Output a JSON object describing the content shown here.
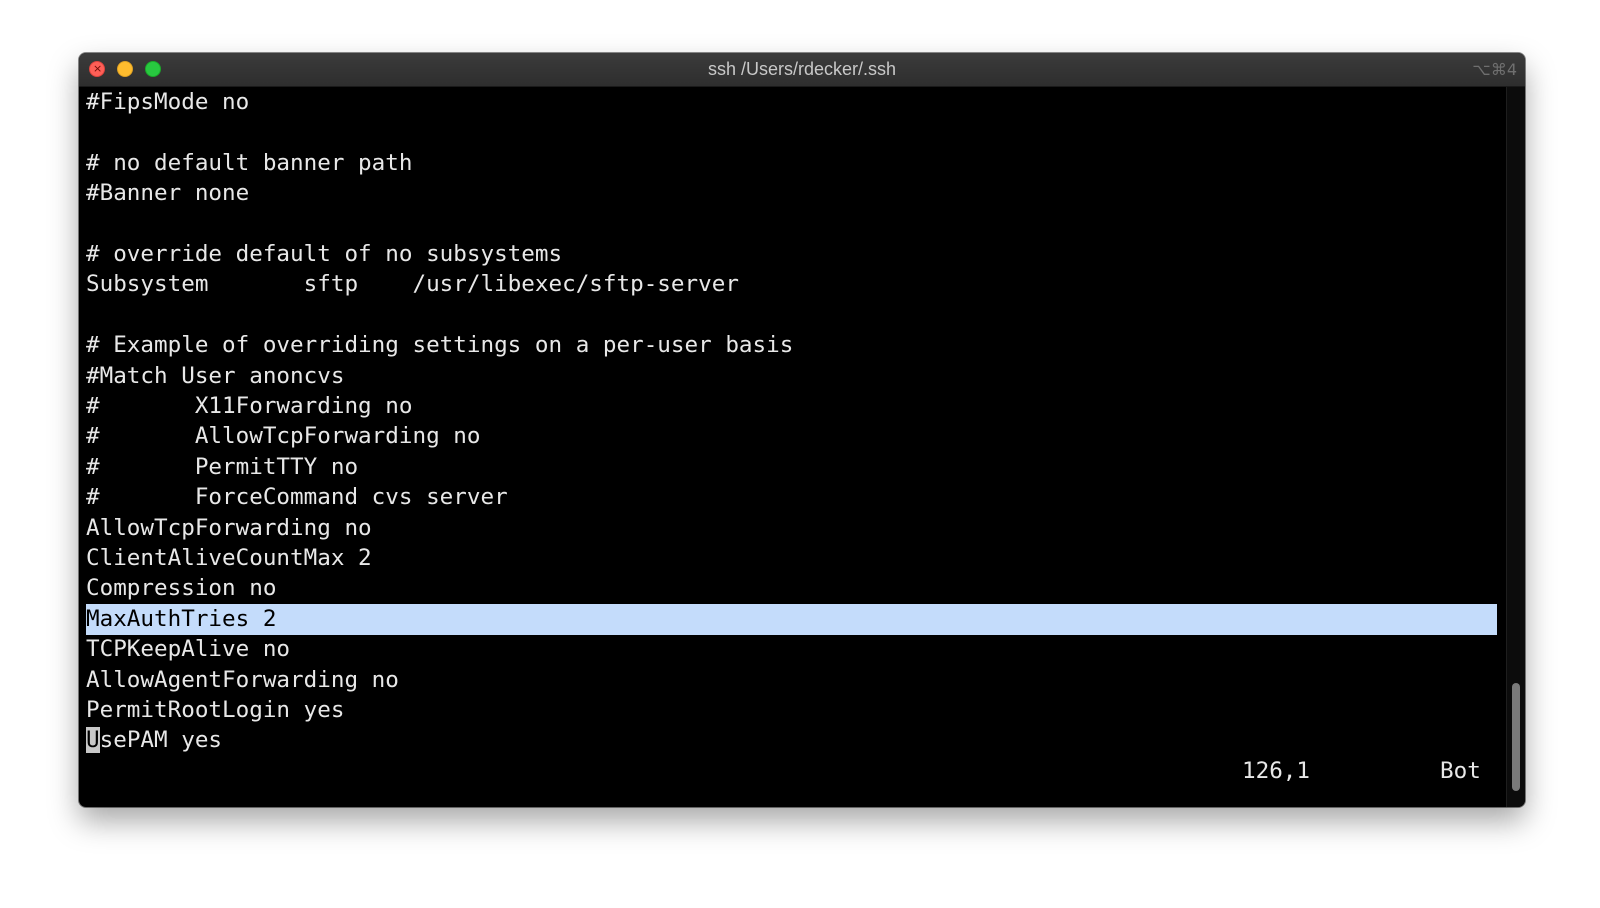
{
  "window": {
    "title": "ssh /Users/rdecker/.ssh",
    "shortcut": "⌥⌘4",
    "close_glyph": "×"
  },
  "editor": {
    "lines": [
      "#FipsMode no",
      "",
      "# no default banner path",
      "#Banner none",
      "",
      "# override default of no subsystems",
      "Subsystem       sftp    /usr/libexec/sftp-server",
      "",
      "# Example of overriding settings on a per-user basis",
      "#Match User anoncvs",
      "#       X11Forwarding no",
      "#       AllowTcpForwarding no",
      "#       PermitTTY no",
      "#       ForceCommand cvs server",
      "AllowTcpForwarding no",
      "ClientAliveCountMax 2",
      "Compression no",
      "MaxAuthTries 2",
      "TCPKeepAlive no",
      "AllowAgentForwarding no",
      "PermitRootLogin yes"
    ],
    "highlighted_line": "MaxAuthTries 2",
    "cursor_line": {
      "cursor_char": "U",
      "rest": "sePAM yes"
    },
    "status": {
      "position": "126,1",
      "scroll": "Bot"
    }
  },
  "colors": {
    "background": "#000000",
    "text": "#e8e8e8",
    "highlight": "#c4dcfb",
    "titlebar": "#2e2e2e"
  },
  "icons": {
    "close": "close-button-icon",
    "minimize": "minimize-button-icon",
    "zoom": "zoom-button-icon"
  }
}
